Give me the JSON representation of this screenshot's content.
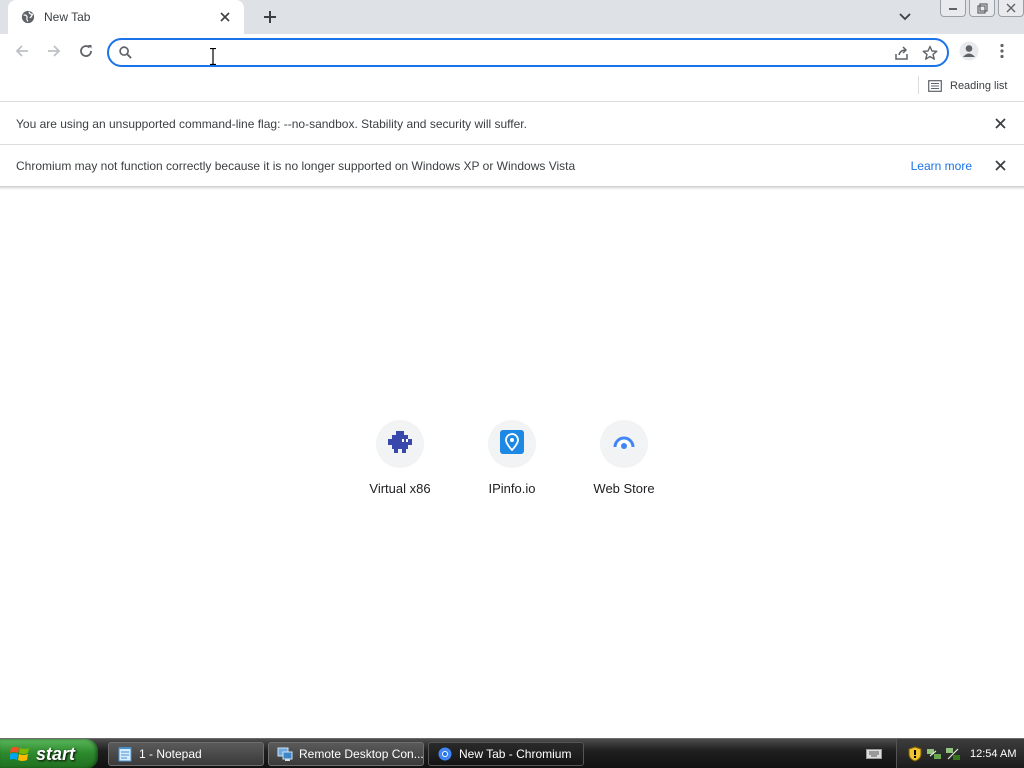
{
  "browser": {
    "tab": {
      "title": "New Tab",
      "favicon": "globe-icon"
    },
    "toolbar": {
      "back": "arrow-left-icon",
      "forward": "arrow-right-icon",
      "reload": "reload-icon",
      "omnibox_value": "",
      "omnibox_placeholder": ""
    },
    "bookmarks_bar": {
      "reading_list_label": "Reading list"
    },
    "infobars": [
      {
        "message": "You are using an unsupported command-line flag: --no-sandbox. Stability and security will suffer."
      },
      {
        "message": "Chromium may not function correctly because it is no longer supported on Windows XP or Windows Vista",
        "link": "Learn more"
      }
    ],
    "shortcuts": [
      {
        "label": "Virtual x86",
        "icon": "virtual-x86-icon"
      },
      {
        "label": "IPinfo.io",
        "icon": "ipinfo-icon"
      },
      {
        "label": "Web Store",
        "icon": "web-store-icon"
      }
    ]
  },
  "taskbar": {
    "start_label": "start",
    "tasks": [
      {
        "label": "1 - Notepad",
        "icon": "notepad-icon"
      },
      {
        "label": "Remote Desktop Con...",
        "icon": "remote-desktop-icon"
      },
      {
        "label": "New Tab - Chromium",
        "icon": "chromium-icon"
      }
    ],
    "clock": "12:54 AM"
  },
  "colors": {
    "accent": "#1a73e8",
    "tabstrip": "#dee1e6",
    "start_green": "#2e8b2e",
    "taskbar": "#1f1f1f"
  }
}
